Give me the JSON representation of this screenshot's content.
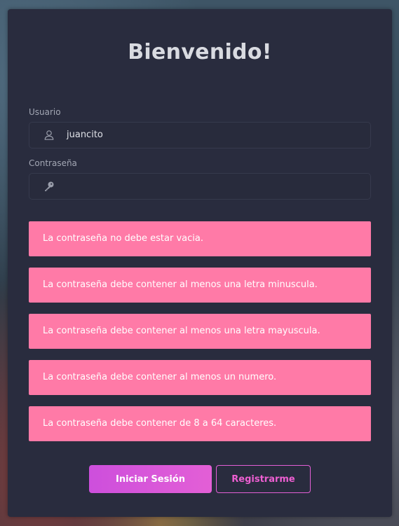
{
  "title": "Bienvenido!",
  "usuario": {
    "label": "Usuario",
    "value": "juancito",
    "icon": "user-icon"
  },
  "contrasena": {
    "label": "Contraseña",
    "value": "",
    "icon": "key-icon"
  },
  "errors": [
    "La contraseña no debe estar vacia.",
    "La contraseña debe contener al menos una letra minuscula.",
    "La contraseña debe contener al menos una letra mayuscula.",
    "La contraseña debe contener al menos un numero.",
    "La contraseña debe contener de 8 a 64 caracteres."
  ],
  "buttons": {
    "login": "Iniciar Sesión",
    "register": "Registrarme"
  },
  "colors": {
    "card": "#292c3e",
    "error": "#ff7aa7",
    "accent": "#e35fd6"
  }
}
